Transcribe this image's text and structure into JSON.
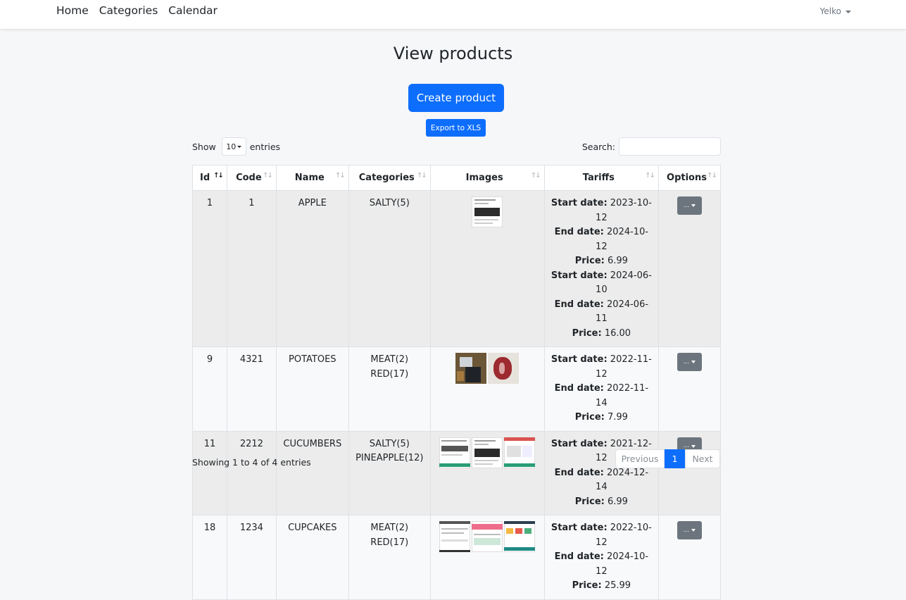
{
  "nav": {
    "links": [
      "Home",
      "Categories",
      "Calendar"
    ],
    "user": "Yelko"
  },
  "page": {
    "title": "View products",
    "create_label": "Create product",
    "export_label": "Export to XLS"
  },
  "length": {
    "prefix": "Show",
    "value": "10",
    "suffix": "entries"
  },
  "search": {
    "label": "Search:",
    "value": ""
  },
  "table": {
    "headers": [
      "Id",
      "Code",
      "Name",
      "Categories",
      "Images",
      "Tariffs",
      "Options"
    ],
    "tariff_labels": {
      "start": "Start date:",
      "end": "End date:",
      "price": "Price:"
    },
    "option_label": "...",
    "rows": [
      {
        "id": "1",
        "code": "1",
        "name": "APPLE",
        "categories": [
          "SALTY(5)"
        ],
        "images": [
          "document"
        ],
        "tariffs": [
          {
            "start": "2023-10-12",
            "end": "2024-10-12",
            "price": "6.99"
          },
          {
            "start": "2024-06-10",
            "end": "2024-06-11",
            "price": "16.00"
          }
        ]
      },
      {
        "id": "9",
        "code": "4321",
        "name": "POTATOES",
        "categories": [
          "MEAT(2)",
          "RED(17)"
        ],
        "images": [
          "photo-dark",
          "photo-meat"
        ],
        "tariffs": [
          {
            "start": "2022-11-12",
            "end": "2022-11-14",
            "price": "7.99"
          }
        ]
      },
      {
        "id": "11",
        "code": "2212",
        "name": "CUCUMBERS",
        "categories": [
          "SALTY(5)",
          "PINEAPPLE(12)"
        ],
        "images": [
          "screenshot-green",
          "document",
          "screenshot-red"
        ],
        "tariffs": [
          {
            "start": "2021-12-12",
            "end": "2024-12-14",
            "price": "6.99"
          }
        ]
      },
      {
        "id": "18",
        "code": "1234",
        "name": "CUPCAKES",
        "categories": [
          "MEAT(2)",
          "RED(17)"
        ],
        "images": [
          "screenshot-gray",
          "screenshot-pink",
          "screenshot-colorful"
        ],
        "tariffs": [
          {
            "start": "2022-10-12",
            "end": "2024-10-12",
            "price": "25.99"
          }
        ]
      }
    ]
  },
  "footer": {
    "info": "Showing 1 to 4 of 4 entries",
    "prev": "Previous",
    "page": "1",
    "next": "Next"
  },
  "colors": {
    "primary": "#0d6efd",
    "secondary": "#6c757d",
    "odd_row": "#ececec"
  }
}
